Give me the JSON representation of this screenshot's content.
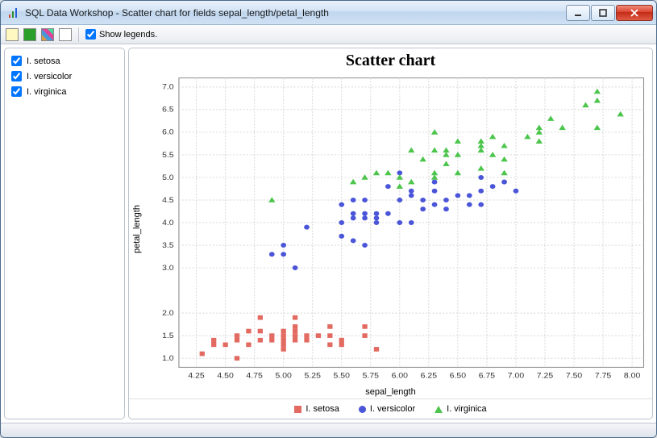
{
  "window": {
    "title": "SQL Data Workshop - Scatter chart for fields sepal_length/petal_length"
  },
  "toolbar": {
    "show_legends_label": "Show legends."
  },
  "sidebar": {
    "items": [
      {
        "label": "I. setosa",
        "checked": true
      },
      {
        "label": "I. versicolor",
        "checked": true
      },
      {
        "label": "I. virginica",
        "checked": true
      }
    ]
  },
  "legend": {
    "items": [
      {
        "label": "I. setosa",
        "color": "#e26a61",
        "shape": "square"
      },
      {
        "label": "I. versicolor",
        "color": "#4a55d8",
        "shape": "circle"
      },
      {
        "label": "I. virginica",
        "color": "#4dc54d",
        "shape": "triangle"
      }
    ]
  },
  "chart_data": {
    "type": "scatter",
    "title": "Scatter chart",
    "xlabel": "sepal_length",
    "ylabel": "petal_length",
    "xlim": [
      4.1,
      8.1
    ],
    "ylim": [
      0.8,
      7.2
    ],
    "xticks": [
      4.25,
      4.5,
      4.75,
      5.0,
      5.25,
      5.5,
      5.75,
      6.0,
      6.25,
      6.5,
      6.75,
      7.0,
      7.25,
      7.5,
      7.75,
      8.0
    ],
    "yticks": [
      1.0,
      1.5,
      2.0,
      3.0,
      3.5,
      4.0,
      4.5,
      5.0,
      5.5,
      6.0,
      6.5,
      7.0
    ],
    "series": [
      {
        "name": "I. setosa",
        "color": "#e26a61",
        "shape": "square",
        "points": [
          [
            4.3,
            1.1
          ],
          [
            4.4,
            1.3
          ],
          [
            4.4,
            1.4
          ],
          [
            4.5,
            1.3
          ],
          [
            4.6,
            1.0
          ],
          [
            4.6,
            1.4
          ],
          [
            4.6,
            1.5
          ],
          [
            4.7,
            1.3
          ],
          [
            4.7,
            1.6
          ],
          [
            4.8,
            1.4
          ],
          [
            4.8,
            1.6
          ],
          [
            4.8,
            1.9
          ],
          [
            4.9,
            1.4
          ],
          [
            4.9,
            1.5
          ],
          [
            5.0,
            1.2
          ],
          [
            5.0,
            1.3
          ],
          [
            5.0,
            1.4
          ],
          [
            5.0,
            1.5
          ],
          [
            5.0,
            1.6
          ],
          [
            5.1,
            1.4
          ],
          [
            5.1,
            1.5
          ],
          [
            5.1,
            1.6
          ],
          [
            5.1,
            1.7
          ],
          [
            5.1,
            1.9
          ],
          [
            5.2,
            1.4
          ],
          [
            5.2,
            1.5
          ],
          [
            5.3,
            1.5
          ],
          [
            5.4,
            1.3
          ],
          [
            5.4,
            1.5
          ],
          [
            5.4,
            1.7
          ],
          [
            5.5,
            1.3
          ],
          [
            5.5,
            1.4
          ],
          [
            5.7,
            1.5
          ],
          [
            5.7,
            1.7
          ],
          [
            5.8,
            1.2
          ]
        ]
      },
      {
        "name": "I. versicolor",
        "color": "#4a55d8",
        "shape": "circle",
        "points": [
          [
            4.9,
            3.3
          ],
          [
            5.0,
            3.3
          ],
          [
            5.0,
            3.5
          ],
          [
            5.1,
            3.0
          ],
          [
            5.2,
            3.9
          ],
          [
            5.5,
            3.7
          ],
          [
            5.5,
            4.0
          ],
          [
            5.5,
            4.4
          ],
          [
            5.6,
            3.6
          ],
          [
            5.6,
            4.1
          ],
          [
            5.6,
            4.2
          ],
          [
            5.6,
            4.5
          ],
          [
            5.7,
            3.5
          ],
          [
            5.7,
            4.1
          ],
          [
            5.7,
            4.2
          ],
          [
            5.7,
            4.5
          ],
          [
            5.8,
            4.0
          ],
          [
            5.8,
            4.1
          ],
          [
            5.8,
            4.2
          ],
          [
            5.9,
            4.2
          ],
          [
            5.9,
            4.8
          ],
          [
            6.0,
            4.0
          ],
          [
            6.0,
            4.5
          ],
          [
            6.0,
            5.1
          ],
          [
            6.1,
            4.0
          ],
          [
            6.1,
            4.6
          ],
          [
            6.1,
            4.7
          ],
          [
            6.2,
            4.3
          ],
          [
            6.2,
            4.5
          ],
          [
            6.3,
            4.4
          ],
          [
            6.3,
            4.7
          ],
          [
            6.3,
            4.9
          ],
          [
            6.4,
            4.3
          ],
          [
            6.4,
            4.5
          ],
          [
            6.5,
            4.6
          ],
          [
            6.6,
            4.4
          ],
          [
            6.6,
            4.6
          ],
          [
            6.7,
            4.4
          ],
          [
            6.7,
            4.7
          ],
          [
            6.7,
            5.0
          ],
          [
            6.8,
            4.8
          ],
          [
            6.9,
            4.9
          ],
          [
            7.0,
            4.7
          ]
        ]
      },
      {
        "name": "I. virginica",
        "color": "#4dc54d",
        "shape": "triangle",
        "points": [
          [
            4.9,
            4.5
          ],
          [
            5.6,
            4.9
          ],
          [
            5.7,
            5.0
          ],
          [
            5.8,
            5.1
          ],
          [
            5.9,
            5.1
          ],
          [
            6.0,
            4.8
          ],
          [
            6.0,
            5.0
          ],
          [
            6.1,
            4.9
          ],
          [
            6.1,
            5.6
          ],
          [
            6.2,
            5.4
          ],
          [
            6.3,
            5.0
          ],
          [
            6.3,
            5.1
          ],
          [
            6.3,
            5.6
          ],
          [
            6.3,
            6.0
          ],
          [
            6.4,
            5.3
          ],
          [
            6.4,
            5.5
          ],
          [
            6.4,
            5.6
          ],
          [
            6.5,
            5.1
          ],
          [
            6.5,
            5.5
          ],
          [
            6.5,
            5.8
          ],
          [
            6.7,
            5.2
          ],
          [
            6.7,
            5.6
          ],
          [
            6.7,
            5.7
          ],
          [
            6.7,
            5.8
          ],
          [
            6.8,
            5.5
          ],
          [
            6.8,
            5.9
          ],
          [
            6.9,
            5.1
          ],
          [
            6.9,
            5.4
          ],
          [
            6.9,
            5.7
          ],
          [
            7.1,
            5.9
          ],
          [
            7.2,
            5.8
          ],
          [
            7.2,
            6.0
          ],
          [
            7.2,
            6.1
          ],
          [
            7.3,
            6.3
          ],
          [
            7.4,
            6.1
          ],
          [
            7.6,
            6.6
          ],
          [
            7.7,
            6.1
          ],
          [
            7.7,
            6.7
          ],
          [
            7.7,
            6.9
          ],
          [
            7.9,
            6.4
          ]
        ]
      }
    ]
  }
}
